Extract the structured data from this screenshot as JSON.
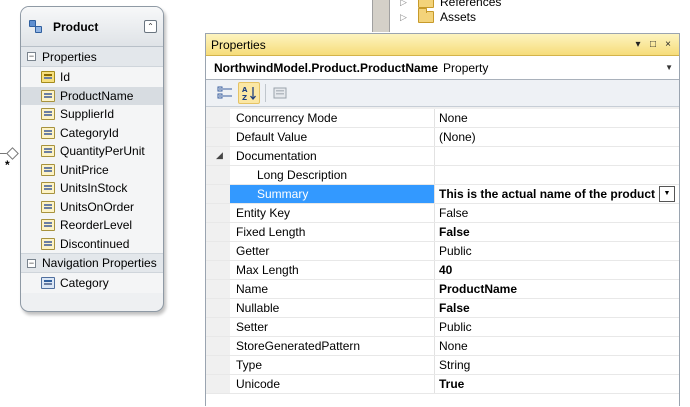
{
  "solution_explorer": {
    "items": [
      {
        "label": "References",
        "icon": "folder-icon"
      },
      {
        "label": "Assets",
        "icon": "folder-icon"
      }
    ]
  },
  "entity": {
    "title": "Product",
    "collapse_glyph": "⌃",
    "properties_header": "Properties",
    "properties": [
      {
        "label": "Id",
        "is_key": true,
        "selected": false
      },
      {
        "label": "ProductName",
        "is_key": false,
        "selected": true
      },
      {
        "label": "SupplierId",
        "is_key": false,
        "selected": false
      },
      {
        "label": "CategoryId",
        "is_key": false,
        "selected": false
      },
      {
        "label": "QuantityPerUnit",
        "is_key": false,
        "selected": false
      },
      {
        "label": "UnitPrice",
        "is_key": false,
        "selected": false
      },
      {
        "label": "UnitsInStock",
        "is_key": false,
        "selected": false
      },
      {
        "label": "UnitsOnOrder",
        "is_key": false,
        "selected": false
      },
      {
        "label": "ReorderLevel",
        "is_key": false,
        "selected": false
      },
      {
        "label": "Discontinued",
        "is_key": false,
        "selected": false
      }
    ],
    "nav_header": "Navigation Properties",
    "nav_properties": [
      {
        "label": "Category"
      }
    ],
    "association_multiplicity": "*"
  },
  "properties_window": {
    "title": "Properties",
    "title_controls": [
      "▾",
      "□",
      "×"
    ],
    "object_name": "NorthwindModel.Product.ProductName",
    "object_type": "Property",
    "toolbar": {
      "categorized_icon": "categorized-icon",
      "alphabetical_icon": "alphabetical-icon",
      "property_pages_icon": "property-pages-icon"
    },
    "rows": [
      {
        "name": "Concurrency Mode",
        "value": "None",
        "bold": false
      },
      {
        "name": "Default Value",
        "value": "(None)",
        "bold": false
      },
      {
        "name": "Documentation",
        "value": "",
        "bold": false,
        "expander": "◢"
      },
      {
        "name": "Long Description",
        "value": "",
        "bold": false,
        "indent": true
      },
      {
        "name": "Summary",
        "value": "This is the actual name of the product",
        "bold": true,
        "indent": true,
        "selected": true,
        "dropdown": true
      },
      {
        "name": "Entity Key",
        "value": "False",
        "bold": false
      },
      {
        "name": "Fixed Length",
        "value": "False",
        "bold": true
      },
      {
        "name": "Getter",
        "value": "Public",
        "bold": false
      },
      {
        "name": "Max Length",
        "value": "40",
        "bold": true
      },
      {
        "name": "Name",
        "value": "ProductName",
        "bold": true
      },
      {
        "name": "Nullable",
        "value": "False",
        "bold": true
      },
      {
        "name": "Setter",
        "value": "Public",
        "bold": false
      },
      {
        "name": "StoreGeneratedPattern",
        "value": "None",
        "bold": false
      },
      {
        "name": "Type",
        "value": "String",
        "bold": false
      },
      {
        "name": "Unicode",
        "value": "True",
        "bold": true
      }
    ]
  },
  "colors": {
    "selection": "#3399ff",
    "titlebar": "#f6dc7a",
    "entity_border": "#8f9aa5"
  }
}
